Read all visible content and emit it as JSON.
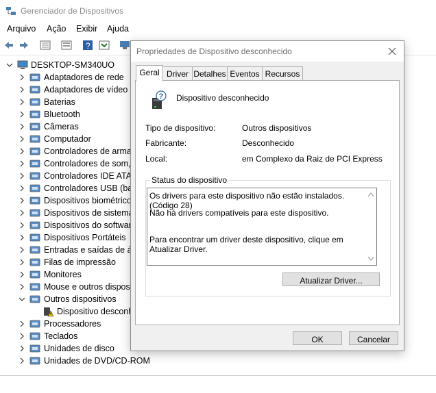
{
  "device_manager": {
    "title": "Gerenciador de Dispositivos",
    "menu": [
      "Arquivo",
      "Ação",
      "Exibir",
      "Ajuda"
    ],
    "tree": {
      "root": "DESKTOP-SM340UO",
      "items": [
        {
          "label": "Adaptadores de rede",
          "icon": "network-adapter-icon",
          "expanded": false
        },
        {
          "label": "Adaptadores de vídeo",
          "icon": "display-adapter-icon",
          "expanded": false
        },
        {
          "label": "Baterias",
          "icon": "battery-icon",
          "expanded": false
        },
        {
          "label": "Bluetooth",
          "icon": "bluetooth-icon",
          "expanded": false
        },
        {
          "label": "Câmeras",
          "icon": "camera-icon",
          "expanded": false
        },
        {
          "label": "Computador",
          "icon": "computer-icon",
          "expanded": false
        },
        {
          "label": "Controladores de armaz",
          "icon": "storage-controller-icon",
          "expanded": false
        },
        {
          "label": "Controladores de som, v",
          "icon": "sound-icon",
          "expanded": false
        },
        {
          "label": "Controladores IDE ATA/A",
          "icon": "ide-controller-icon",
          "expanded": false
        },
        {
          "label": "Controladores USB (barr",
          "icon": "usb-icon",
          "expanded": false
        },
        {
          "label": "Dispositivos biométricos",
          "icon": "fingerprint-icon",
          "expanded": false
        },
        {
          "label": "Dispositivos de sistema",
          "icon": "system-device-icon",
          "expanded": false
        },
        {
          "label": "Dispositivos do software",
          "icon": "software-device-icon",
          "expanded": false
        },
        {
          "label": "Dispositivos Portáteis",
          "icon": "portable-device-icon",
          "expanded": false
        },
        {
          "label": "Entradas e saídas de áud",
          "icon": "audio-io-icon",
          "expanded": false
        },
        {
          "label": "Filas de impressão",
          "icon": "printer-icon",
          "expanded": false
        },
        {
          "label": "Monitores",
          "icon": "monitor-icon",
          "expanded": false
        },
        {
          "label": "Mouse e outros disposit",
          "icon": "mouse-icon",
          "expanded": false
        },
        {
          "label": "Outros dispositivos",
          "icon": "other-devices-icon",
          "expanded": true
        },
        {
          "label": "Dispositivo desconh",
          "icon": "unknown-device-warning-icon",
          "child": true
        },
        {
          "label": "Processadores",
          "icon": "processor-icon",
          "expanded": false
        },
        {
          "label": "Teclados",
          "icon": "keyboard-icon",
          "expanded": false
        },
        {
          "label": "Unidades de disco",
          "icon": "disk-drive-icon",
          "expanded": false
        },
        {
          "label": "Unidades de DVD/CD-ROM",
          "icon": "dvd-drive-icon",
          "expanded": false
        }
      ]
    }
  },
  "dialog": {
    "title": "Propriedades de Dispositivo desconhecido",
    "tabs": [
      "Geral",
      "Driver",
      "Detalhes",
      "Eventos",
      "Recursos"
    ],
    "active_tab": "Geral",
    "device_name": "Dispositivo desconhecido",
    "properties": {
      "type_label": "Tipo de dispositivo:",
      "type_value": "Outros dispositivos",
      "manufacturer_label": "Fabricante:",
      "manufacturer_value": "Desconhecido",
      "location_label": "Local:",
      "location_value": "em Complexo da Raiz de PCI Express"
    },
    "status_group_label": "Status do dispositivo",
    "status_lines": [
      "Os drivers para este dispositivo não estão instalados. (Código 28)",
      "Não há drivers compatíveis para este dispositivo.",
      "Para encontrar um driver deste dispositivo, clique em Atualizar Driver."
    ],
    "update_driver_button": "Atualizar Driver...",
    "ok_button": "OK",
    "cancel_button": "Cancelar"
  },
  "colors": {
    "accent": "#0078d7",
    "dialog_bg": "#f0f0f0",
    "button_bg": "#e1e1e1",
    "warning": "#f5c400"
  }
}
